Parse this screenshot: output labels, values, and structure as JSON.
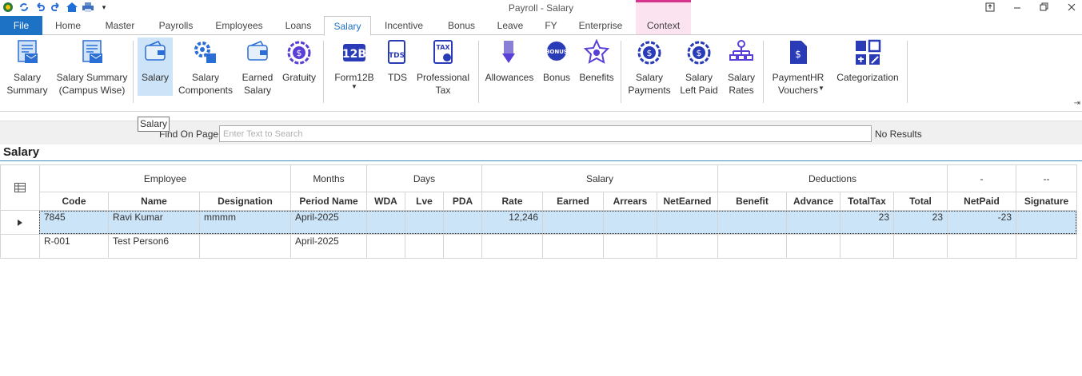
{
  "window": {
    "title": "Payroll - Salary",
    "qat_icons": [
      "app-logo-icon",
      "refresh-icon",
      "undo-icon",
      "redo-icon",
      "home-icon",
      "print-icon",
      "customize-dropdown-icon"
    ]
  },
  "tabs": [
    "File",
    "Home",
    "Master",
    "Payrolls",
    "Employees",
    "Loans",
    "Salary",
    "Incentive",
    "Bonus",
    "Leave",
    "FY",
    "Enterprise",
    "Context"
  ],
  "active_tab": "Salary",
  "ribbon": {
    "salary_summary": "Salary\nSummary",
    "salary_summary_campus": "Salary Summary\n(Campus Wise)",
    "salary": "Salary",
    "salary_components": "Salary\nComponents",
    "earned_salary": "Earned\nSalary",
    "gratuity": "Gratuity",
    "form12b": "Form12B",
    "tds": "TDS",
    "professional_tax": "Professional\nTax",
    "allowances": "Allowances",
    "bonus": "Bonus",
    "benefits": "Benefits",
    "salary_payments": "Salary\nPayments",
    "salary_left_paid": "Salary\nLeft Paid",
    "salary_rates": "Salary\nRates",
    "paymenthr_vouchers": "PaymentHR\nVouchers",
    "categorization": "Categorization"
  },
  "tooltip": "Salary",
  "find": {
    "label": "Find On Page",
    "placeholder": "Enter Text to Search",
    "result": "No Results"
  },
  "section_title": "Salary",
  "grid": {
    "bands": [
      "Employee",
      "Months",
      "Days",
      "Salary",
      "Deductions",
      "-",
      "--"
    ],
    "columns": [
      "Code",
      "Name",
      "Designation",
      "Period Name",
      "WDA",
      "Lve",
      "PDA",
      "Rate",
      "Earned",
      "Arrears",
      "NetEarned",
      "Benefit",
      "Advance",
      "TotalTax",
      "Total",
      "NetPaid",
      "Signature"
    ],
    "rows": [
      [
        "7845",
        "Ravi Kumar",
        "mmmm",
        "April-2025",
        "",
        "",
        "",
        "12,246",
        "",
        "",
        "",
        "",
        "",
        "23",
        "23",
        "-23",
        ""
      ],
      [
        "R-001",
        "Test Person6",
        "",
        "April-2025",
        "",
        "",
        "",
        "",
        "",
        "",
        "",
        "",
        "",
        "",
        "",
        "",
        ""
      ]
    ],
    "selected_row": 0
  },
  "colors": {
    "file_tab": "#1e72c5",
    "context_tab": "#fbe3f0",
    "context_accent": "#d6338d",
    "selected_row": "#cce4f7",
    "ribbon_icon_blue": "#2b6fd6",
    "ribbon_icon_purple": "#5a3fd6"
  }
}
